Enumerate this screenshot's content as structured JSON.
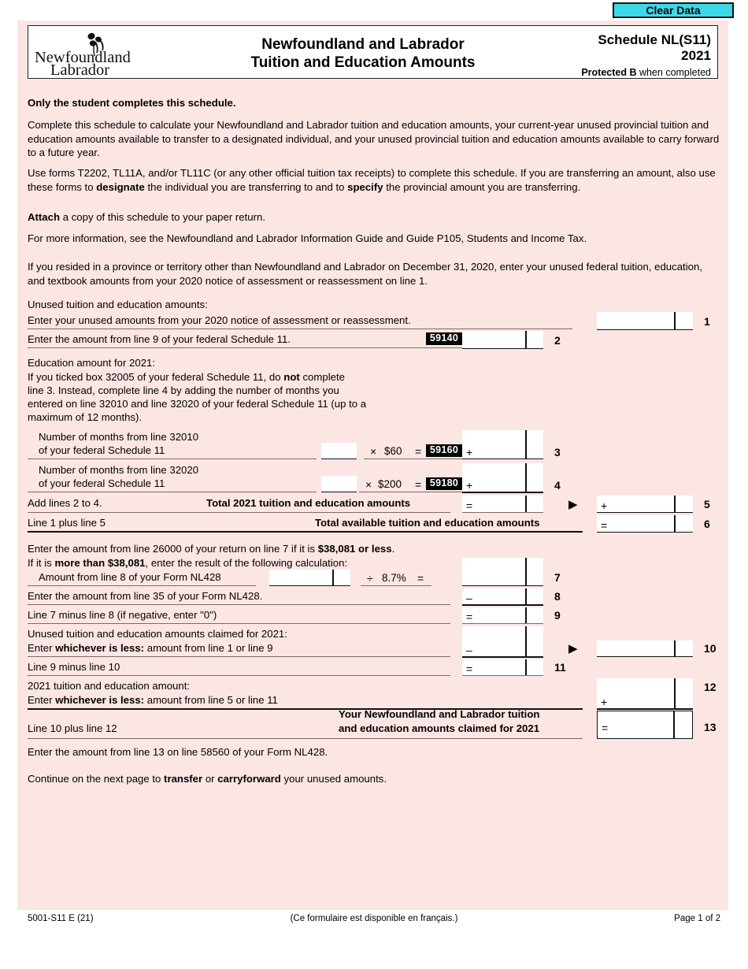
{
  "toolbar": {
    "clear_data_label": "Clear Data",
    "clear_data_color": "#3dd8e8"
  },
  "header": {
    "logo_line1": "Newfoundland",
    "logo_line2": "Labrador",
    "title_line1": "Newfoundland and Labrador",
    "title_line2": "Tuition and Education Amounts",
    "schedule": "Schedule NL(S11)",
    "year": "2021",
    "protected_bold": "Protected B",
    "protected_rest": " when completed"
  },
  "intro": {
    "heading": "Only the student completes this schedule.",
    "p1": "Complete this schedule to calculate your Newfoundland and Labrador tuition and education amounts, your current-year unused provincial tuition and education amounts available to transfer to a designated individual, and your unused provincial tuition and education amounts available to carry forward to a future year.",
    "p2_a": "Use forms T2202, TL11A, and/or TL11C (or any other official tuition tax receipts) to complete this schedule. If you are transferring an amount, also use these forms to ",
    "p2_b": "designate",
    "p2_c": " the individual you are transferring to and to ",
    "p2_d": "specify",
    "p2_e": " the provincial amount you are transferring.",
    "p3_b": "Attach",
    "p3_rest": " a copy of this schedule to your paper return.",
    "p4": "For more information, see the Newfoundland and Labrador Information Guide and Guide P105, Students and Income Tax.",
    "p5": "If you resided in a province or territory other than Newfoundland and Labrador on December 31, 2020, enter your unused federal tuition, education, and textbook amounts from your 2020 notice of assessment or reassessment on line 1."
  },
  "section_unused": {
    "title": "Unused tuition and education amounts:",
    "line1_label": "Enter your unused amounts from your 2020 notice of assessment or reassessment.",
    "line1_no": "1",
    "line2_label": "Enter the amount from line 9 of your federal Schedule 11.",
    "line2_code": "59140",
    "line2_no": "2"
  },
  "section_education": {
    "title": "Education amount for 2021:",
    "note_a": "If you ticked box 32005 of your federal Schedule 11, do ",
    "note_b": "not",
    "note_c": " complete",
    "note_l2": "line 3. Instead, complete line 4 by adding the number of months you",
    "note_l3": "entered on line 32010 and line 32020 of your federal Schedule 11 (up to a",
    "note_l4": "maximum of 12 months).",
    "line3_label_l1": "Number of months from line 32010",
    "line3_label_l2": "of your federal Schedule 11",
    "line3_times": "×",
    "line3_rate": "$60",
    "line3_eq": "=",
    "line3_code": "59160",
    "line3_plus": "+",
    "line3_no": "3",
    "line4_label_l1": "Number of months from line 32020",
    "line4_label_l2": "of your federal Schedule 11",
    "line4_times": "×",
    "line4_rate": "$200",
    "line4_eq": "=",
    "line4_code": "59180",
    "line4_plus": "+",
    "line4_no": "4",
    "line5_left": "Add lines 2 to 4.",
    "line5_caption": "Total 2021 tuition and education amounts",
    "line5_eq": "=",
    "line5_plus": "+",
    "line5_no": "5",
    "line6_left": "Line 1 plus line 5",
    "line6_caption": "Total available tuition and education amounts",
    "line6_eq": "=",
    "line6_no": "6"
  },
  "section_claim": {
    "intro_a": "Enter the amount from line 26000 of your return on line 7 if it is ",
    "intro_b": "$38,081 or less",
    "intro_c": ".",
    "intro2_a": "If it is ",
    "intro2_b": "more than $38,081",
    "intro2_c": ", enter the result of the following calculation:",
    "line7_label": "Amount from line 8 of your Form NL428",
    "line7_div": "÷",
    "line7_rate": "8.7%",
    "line7_eq": "=",
    "line7_no": "7",
    "line8_label": "Enter the amount from line 35 of your Form NL428.",
    "line8_minus": "–",
    "line8_no": "8",
    "line9_label": "Line 7 minus line 8 (if negative, enter \"0\")",
    "line9_eq": "=",
    "line9_no": "9",
    "line10_title": "Unused tuition and education amounts claimed for 2021:",
    "line10_label_a": "Enter ",
    "line10_label_b": "whichever is less:",
    "line10_label_c": " amount from line 1 or line 9",
    "line10_minus": "–",
    "line10_no": "10",
    "line11_label": "Line 9 minus line 10",
    "line11_eq": "=",
    "line11_no": "11",
    "line12_title": "2021 tuition and education amount:",
    "line12_label_a": "Enter ",
    "line12_label_b": "whichever is less:",
    "line12_label_c": " amount from line 5 or line 11",
    "line12_plus": "+",
    "line12_no": "12",
    "line13_left": "Line 10 plus line 12",
    "line13_caption_l1": "Your Newfoundland and Labrador tuition",
    "line13_caption_l2": "and education amounts claimed for 2021",
    "line13_eq": "=",
    "line13_no": "13"
  },
  "closing": {
    "p1": "Enter the amount from line 13 on line 58560 of your Form NL428.",
    "p2_a": "Continue on the next page to ",
    "p2_b": "transfer",
    "p2_c": " or ",
    "p2_d": "carryforward",
    "p2_e": " your unused amounts."
  },
  "footer": {
    "left": "5001-S11 E (21)",
    "center": "(Ce formulaire est disponible en français.)",
    "right": "Page 1 of 2"
  }
}
